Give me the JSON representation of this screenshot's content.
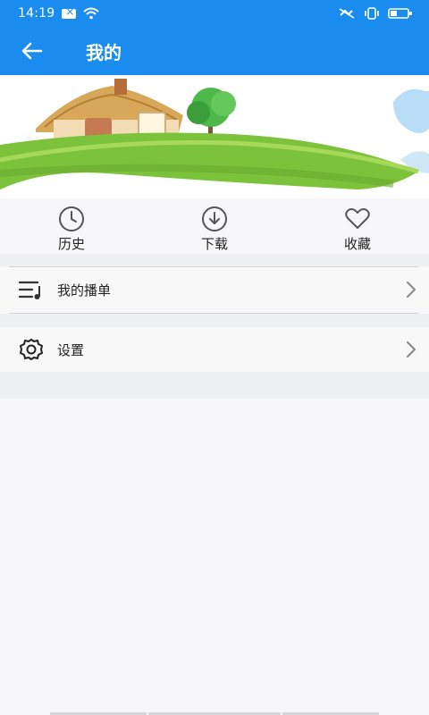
{
  "status_bar": {
    "time": "14:19",
    "icons": [
      "notification-icon",
      "wifi-icon",
      "mute-icon",
      "vibrate-icon",
      "battery-icon"
    ]
  },
  "app_bar": {
    "title": "我的",
    "back_icon": "arrow-left-icon"
  },
  "quick_actions": [
    {
      "label": "历史",
      "icon": "clock-icon"
    },
    {
      "label": "下载",
      "icon": "download-circle-icon"
    },
    {
      "label": "收藏",
      "icon": "heart-icon"
    }
  ],
  "menu": [
    {
      "label": "我的播单",
      "icon": "playlist-icon"
    },
    {
      "label": "设置",
      "icon": "gear-icon"
    }
  ],
  "colors": {
    "primary": "#1a8cf0",
    "background": "#f7f7f9",
    "section_band": "#eef0f4",
    "text": "#222222",
    "icon_gray": "#555555"
  }
}
